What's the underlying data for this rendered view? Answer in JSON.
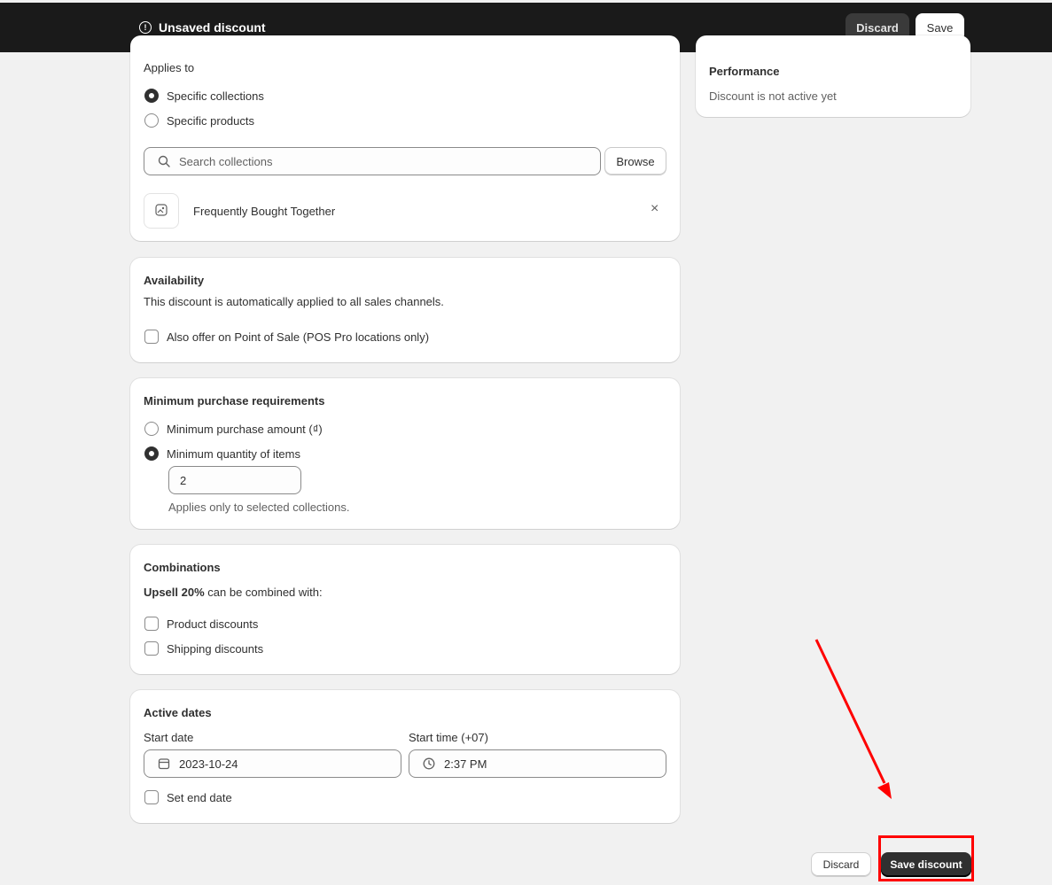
{
  "header": {
    "title": "Unsaved discount",
    "discard_label": "Discard",
    "save_label": "Save"
  },
  "applies_to": {
    "heading": "Applies to",
    "options": [
      "Specific collections",
      "Specific products"
    ],
    "selected": "Specific collections",
    "search_placeholder": "Search collections",
    "browse_label": "Browse",
    "selected_items": [
      "Frequently Bought Together"
    ]
  },
  "availability": {
    "heading": "Availability",
    "description": "This discount is automatically applied to all sales channels.",
    "pos_label": "Also offer on Point of Sale (POS Pro locations only)",
    "pos_checked": false
  },
  "minimum_requirements": {
    "heading": "Minimum purchase requirements",
    "options": [
      "Minimum purchase amount (₫)",
      "Minimum quantity of items"
    ],
    "selected": "Minimum quantity of items",
    "quantity_value": "2",
    "help_text": "Applies only to selected collections."
  },
  "combinations": {
    "heading": "Combinations",
    "discount_name": "Upsell 20%",
    "combine_text": "can be combined with:",
    "options": [
      "Product discounts",
      "Shipping discounts"
    ]
  },
  "active_dates": {
    "heading": "Active dates",
    "start_date_label": "Start date",
    "start_date_value": "2023-10-24",
    "start_time_label": "Start time (+07)",
    "start_time_value": "2:37 PM",
    "end_date_label": "Set end date"
  },
  "performance": {
    "heading": "Performance",
    "status": "Discount is not active yet"
  },
  "footer": {
    "discard_label": "Discard",
    "save_label": "Save discount"
  },
  "annotation_color": "#ff0000"
}
